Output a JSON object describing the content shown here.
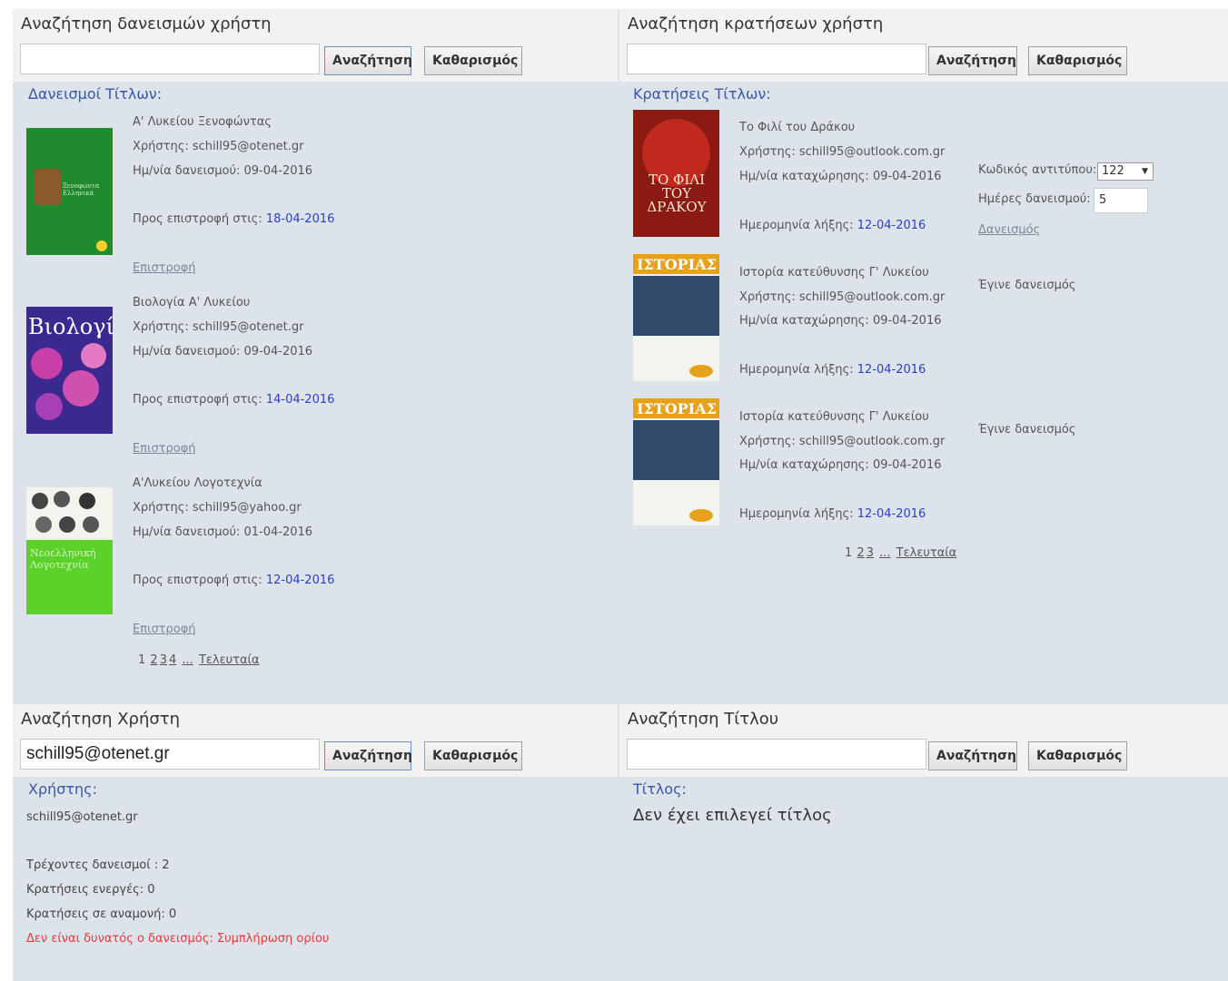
{
  "loans_panel": {
    "title": "Αναζήτηση δανεισμών χρήστη",
    "search_value": "",
    "search_button": "Αναζήτηση",
    "clear_button": "Καθαρισμός",
    "section_label": "Δανεισμοί Τίτλων:",
    "items": [
      {
        "title": "Α' Λυκείου Ξενοφώντας",
        "user_label": "Χρήστης:",
        "user": "schill95@otenet.gr",
        "date_label": "Ημ/νία δανεισμού:",
        "date": "09-04-2016",
        "return_label": "Προς επιστροφή στις:",
        "return_date": "18-04-2016",
        "action": "Επιστροφή",
        "cover_text": "Ξενοφώντα Ελληνικά",
        "cover_color": "#1f8a2d"
      },
      {
        "title": "Βιολογία Α' Λυκείου",
        "user_label": "Χρήστης:",
        "user": "schill95@otenet.gr",
        "date_label": "Ημ/νία δανεισμού:",
        "date": "09-04-2016",
        "return_label": "Προς επιστροφή στις:",
        "return_date": "14-04-2016",
        "action": "Επιστροφή",
        "cover_text": "Βιολογία",
        "cover_color": "#3a2a8f"
      },
      {
        "title": "Α'Λυκείου Λογοτεχνία",
        "user_label": "Χρήστης:",
        "user": "schill95@yahoo.gr",
        "date_label": "Ημ/νία δανεισμού:",
        "date": "01-04-2016",
        "return_label": "Προς επιστροφή στις:",
        "return_date": "12-04-2016",
        "action": "Επιστροφή",
        "cover_text": "Νεοελληνική Λογοτεχνία",
        "cover_color": "#5bd12a"
      }
    ],
    "pager": {
      "current": "1",
      "pages": [
        "2",
        "3",
        "4"
      ],
      "more": "...",
      "last": "Τελευταία"
    }
  },
  "reservations_panel": {
    "title": "Αναζήτηση κρατήσεων χρήστη",
    "search_value": "",
    "search_button": "Αναζήτηση",
    "clear_button": "Καθαρισμός",
    "section_label": "Κρατήσεις Τίτλων:",
    "items": [
      {
        "title": "Το Φιλί του Δράκου",
        "user_label": "Χρήστης:",
        "user": "schill95@outlook.com.gr",
        "date_label": "Ημ/νία καταχώρησης:",
        "date": "09-04-2016",
        "expire_label": "Ημερομηνία λήξης:",
        "expire_date": "12-04-2016",
        "cover_text": "ΤΟ ΦΙΛΙ ΤΟΥ ΔΡΑΚΟΥ",
        "cover_color": "#8a1a12"
      },
      {
        "title": "Ιστορία κατεύθυνσης Γ' Λυκείου",
        "user_label": "Χρήστης:",
        "user": "schill95@outlook.com.gr",
        "date_label": "Ημ/νία καταχώρησης:",
        "date": "09-04-2016",
        "expire_label": "Ημερομηνία λήξης:",
        "expire_date": "12-04-2016",
        "status": "Έγινε δανεισμός",
        "cover_text": "ΙΣΤΟΡΙΑΣ",
        "cover_color": "#e8a11a"
      },
      {
        "title": "Ιστορία κατεύθυνσης Γ' Λυκείου",
        "user_label": "Χρήστης:",
        "user": "schill95@outlook.com.gr",
        "date_label": "Ημ/νία καταχώρησης:",
        "date": "09-04-2016",
        "expire_label": "Ημερομηνία λήξης:",
        "expire_date": "12-04-2016",
        "status": "Έγινε δανεισμός",
        "cover_text": "ΙΣΤΟΡΙΑΣ",
        "cover_color": "#e8a11a"
      }
    ],
    "loan_form": {
      "copy_code_label": "Κωδικός αντιτύπου:",
      "copy_code_value": "122",
      "loan_days_label": "Ημέρες δανεισμού:",
      "loan_days_value": "5",
      "loan_link": "Δανεισμός"
    },
    "pager": {
      "current": "1",
      "pages": [
        "2",
        "3"
      ],
      "more": "...",
      "last": "Τελευταία"
    }
  },
  "user_panel": {
    "title": "Αναζήτηση Χρήστη",
    "search_value": "schill95@otenet.gr",
    "search_button": "Αναζήτηση",
    "clear_button": "Καθαρισμός",
    "section_label": "Χρήστης:",
    "user": "schill95@otenet.gr",
    "current_loans": "Τρέχοντες δανεισμοί : 2",
    "active_reservations": "Κρατήσεις ενεργές: 0",
    "pending_reservations": "Κρατήσεις σε αναμονή: 0",
    "warning": "Δεν είναι δυνατός ο δανεισμός: Συμπλήρωση ορίου"
  },
  "title_panel": {
    "title": "Αναζήτηση Τίτλου",
    "search_value": "",
    "search_button": "Αναζήτηση",
    "clear_button": "Καθαρισμός",
    "section_label": "Τίτλος:",
    "empty_message": "Δεν έχει επιλεγεί τίτλος"
  }
}
